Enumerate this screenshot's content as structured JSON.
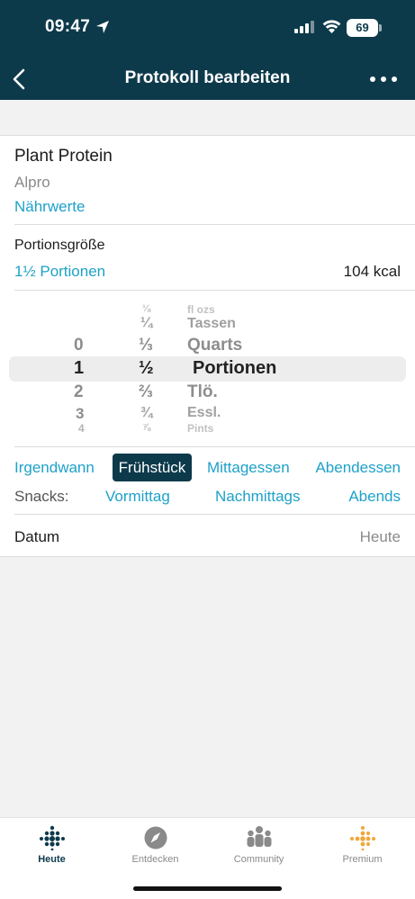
{
  "status": {
    "time": "09:47",
    "battery": "69"
  },
  "nav": {
    "title": "Protokoll bearbeiten"
  },
  "food": {
    "name": "Plant Protein",
    "brand": "Alpro",
    "nutrients_link": "Nährwerte"
  },
  "portion": {
    "label": "Portionsgröße",
    "value": "1½ Portionen",
    "kcal": "104 kcal"
  },
  "picker": {
    "col1": [
      "0",
      "1",
      "2",
      "3",
      "4"
    ],
    "col2": [
      "⅛",
      "¼",
      "⅓",
      "½",
      "⅔",
      "¾",
      "⅞"
    ],
    "col3": [
      "fl ozs",
      "Tassen",
      "Quarts",
      "Portionen",
      "Tlö.",
      "Essl.",
      "Pints"
    ]
  },
  "meals": {
    "items": [
      "Irgendwann",
      "Frühstück",
      "Mittagessen",
      "Abendessen"
    ],
    "selected": "Frühstück"
  },
  "snacks": {
    "label": "Snacks:",
    "items": [
      "Vormittag",
      "Nachmittags",
      "Abends"
    ]
  },
  "date": {
    "label": "Datum",
    "value": "Heute"
  },
  "tabs": [
    {
      "label": "Heute",
      "icon": "fitbit-dots-icon"
    },
    {
      "label": "Entdecken",
      "icon": "compass-icon"
    },
    {
      "label": "Community",
      "icon": "community-icon"
    },
    {
      "label": "Premium",
      "icon": "premium-dots-icon"
    }
  ],
  "colors": {
    "header": "#0d3a4b",
    "accent": "#1ea1c9",
    "premium": "#f0a73a"
  }
}
